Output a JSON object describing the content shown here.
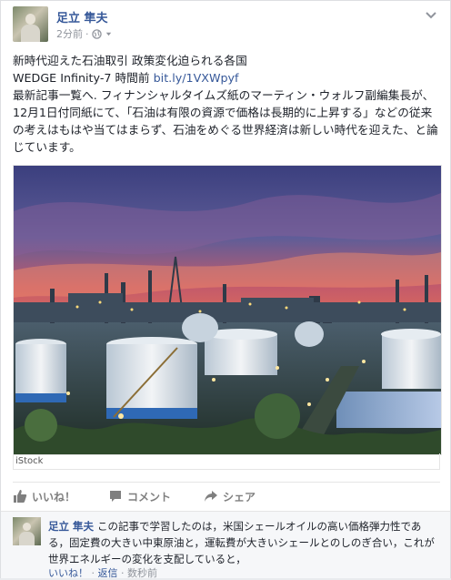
{
  "post": {
    "author": "足立 隼夫",
    "time": "2分前",
    "sep": "·",
    "title": "新時代迎えた石油取引 政策変化迫られる各国",
    "source": "WEDGE Infinity-7 時間前",
    "link": "bit.ly/1VXWpyf",
    "body": "最新記事一覧へ. フィナンシャルタイムズ紙のマーティン・ウォルフ副編集長が、12月1日付同紙にて、「石油は有限の資源で価格は長期的に上昇する」などの従来の考えはもはや当てはまらず、石油をめぐる世界経済は新しい時代を迎えた、と論じています。",
    "image_credit": "iStock"
  },
  "actions": {
    "like": "いいね！",
    "comment": "コメント",
    "share": "シェア"
  },
  "comment": {
    "author": "足立 隼夫",
    "text": "この記事で学習したのは，米国シェールオイルの高い価格弾力性である，固定費の大きい中東原油と，運転費が大きいシェールとのしのぎ合い，これが世界エネルギーの変化を支配していると，",
    "like": "いいね！",
    "reply": "返信",
    "time": "数秒前",
    "dot": "·"
  },
  "colors": {
    "link": "#365899",
    "text": "#1d2129",
    "muted": "#90949c"
  }
}
